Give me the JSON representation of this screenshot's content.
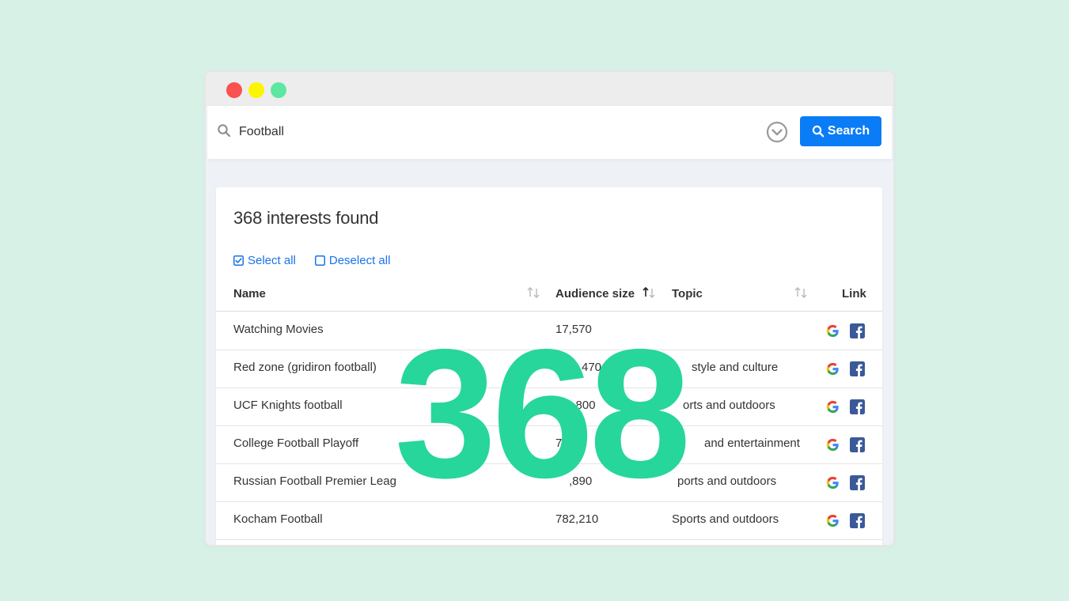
{
  "search": {
    "value": "Football",
    "button_label": "Search"
  },
  "results": {
    "title": "368 interests found",
    "select_all": "Select all",
    "deselect_all": "Deselect all"
  },
  "table": {
    "headers": {
      "name": "Name",
      "audience": "Audience size",
      "topic": "Topic",
      "link": "Link"
    },
    "rows": [
      {
        "name": "Watching Movies",
        "audience": "17,570",
        "topic": ""
      },
      {
        "name": "Red zone (gridiron football)",
        "audience": "470",
        "topic": "style and culture"
      },
      {
        "name": "UCF Knights football",
        "audience": "1,800",
        "topic": "orts and outdoors"
      },
      {
        "name": "College Football Playoff",
        "audience": "7",
        "topic": "and entertainment"
      },
      {
        "name": "Russian Football Premier Leag",
        "audience": ",890",
        "topic": "ports and outdoors"
      },
      {
        "name": "Kocham Football",
        "audience": "782,210",
        "topic": "Sports and outdoors"
      }
    ]
  },
  "overlay": {
    "number": "368"
  },
  "colors": {
    "background": "#d8f1e7",
    "accent": "#0a7cf6",
    "overlay": "#27d69a",
    "facebook": "#3b5998"
  }
}
